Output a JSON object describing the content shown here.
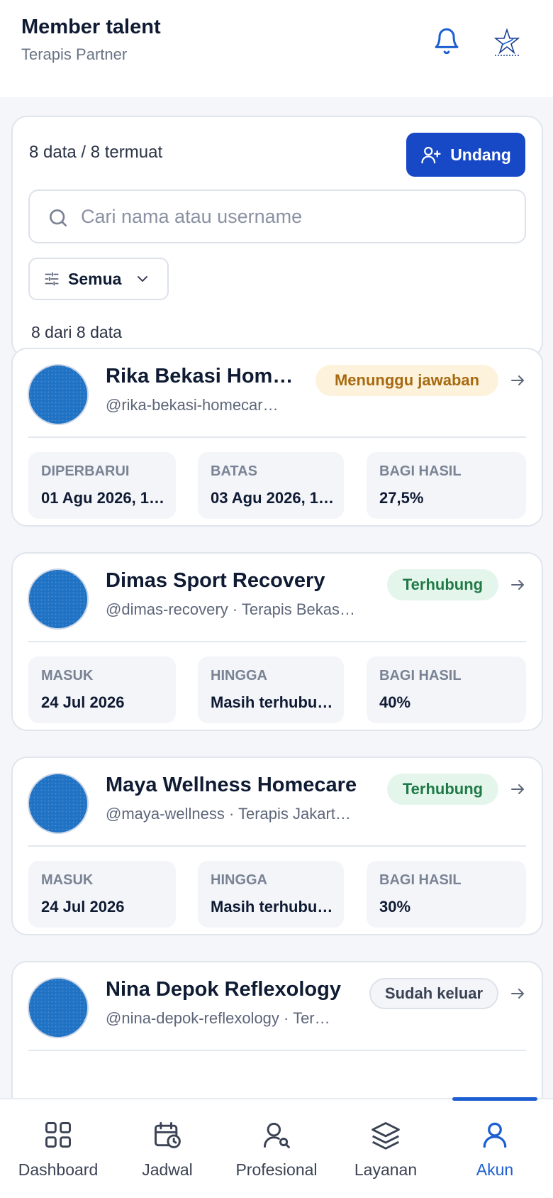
{
  "header": {
    "title": "Member talent",
    "subtitle": "Terapis Partner",
    "bell_icon": "bell-icon",
    "logo_icon": "brand-logo"
  },
  "toolbar": {
    "count_text": "8 data / 8 termuat",
    "invite_label": "Undang",
    "search_placeholder": "Cari nama atau username",
    "search_value": "",
    "filter_label": "Semua",
    "result_text": "8 dari 8 data"
  },
  "members": [
    {
      "name": "Rika Bekasi Home…",
      "handle": "@rika-bekasi-homecar…",
      "status": "Menunggu jawaban",
      "status_type": "pending",
      "stats": [
        {
          "label": "DIPERBARUI",
          "value": "01 Agu 2026, 10…"
        },
        {
          "label": "BATAS",
          "value": "03 Agu 2026, 10…"
        },
        {
          "label": "BAGI HASIL",
          "value": "27,5%"
        }
      ]
    },
    {
      "name": "Dimas Sport Recovery",
      "handle": "@dimas-recovery · Terapis Bekas…",
      "status": "Terhubung",
      "status_type": "ok",
      "stats": [
        {
          "label": "MASUK",
          "value": "24 Jul 2026"
        },
        {
          "label": "HINGGA",
          "value": "Masih terhubu…"
        },
        {
          "label": "BAGI HASIL",
          "value": "40%"
        }
      ]
    },
    {
      "name": "Maya Wellness Homecare",
      "handle": "@maya-wellness · Terapis Jakart…",
      "status": "Terhubung",
      "status_type": "ok",
      "stats": [
        {
          "label": "MASUK",
          "value": "24 Jul 2026"
        },
        {
          "label": "HINGGA",
          "value": "Masih terhubu…"
        },
        {
          "label": "BAGI HASIL",
          "value": "30%"
        }
      ]
    },
    {
      "name": "Nina Depok Reflexology",
      "handle": "@nina-depok-reflexology · Ter…",
      "status": "Sudah keluar",
      "status_type": "out",
      "stats": []
    }
  ],
  "nav": {
    "items": [
      {
        "label": "Dashboard",
        "icon": "dashboard-icon"
      },
      {
        "label": "Jadwal",
        "icon": "calendar-icon"
      },
      {
        "label": "Profesional",
        "icon": "user-search-icon"
      },
      {
        "label": "Layanan",
        "icon": "layers-icon"
      },
      {
        "label": "Akun",
        "icon": "user-icon"
      }
    ],
    "active": "Akun"
  },
  "colors": {
    "primary": "#1748c6",
    "accent": "#1d5fd1",
    "pending_bg": "#fdf3dd",
    "pending_text": "#a86a10",
    "ok_bg": "#e4f6ec",
    "ok_text": "#1f7a47"
  }
}
